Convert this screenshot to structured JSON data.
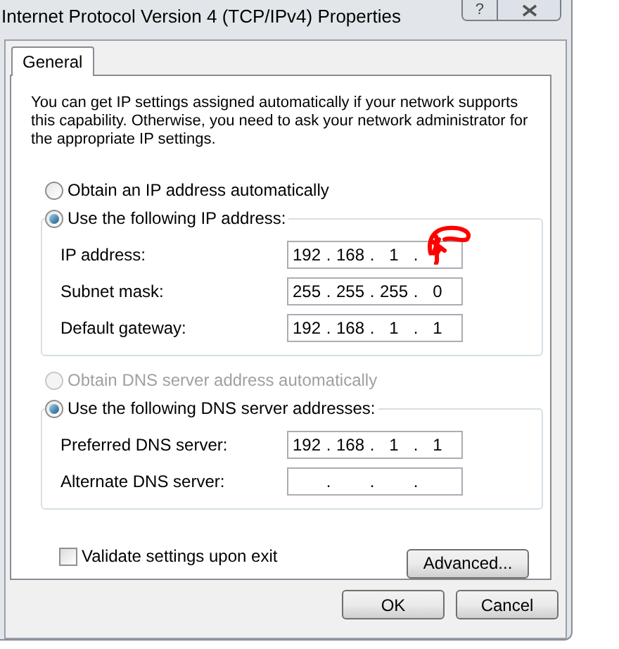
{
  "window": {
    "title": "Internet Protocol Version 4 (TCP/IPv4) Properties",
    "help": "?"
  },
  "tabs": [
    {
      "label": "General",
      "selected": true
    }
  ],
  "intro": "You can get IP settings assigned automatically if your network supports this capability. Otherwise, you need to ask your network administrator for the appropriate IP settings.",
  "ip_auto": {
    "label": "Obtain an IP address automatically",
    "selected": false,
    "disabled": false
  },
  "ip_manual": {
    "label": "Use the following IP address:",
    "selected": true,
    "disabled": false,
    "fields": [
      {
        "label": "IP address:",
        "octets": [
          "192",
          "168",
          "1"
        ],
        "separators": [
          ".",
          ".",
          "."
        ],
        "scribbled": true
      },
      {
        "label": "Subnet mask:",
        "octets": [
          "255",
          "255",
          "255",
          "0"
        ],
        "separators": [
          ".",
          ".",
          "."
        ],
        "scribbled": false
      },
      {
        "label": "Default gateway:",
        "octets": [
          "192",
          "168",
          "1",
          "1"
        ],
        "separators": [
          ".",
          ".",
          "."
        ],
        "scribbled": false
      }
    ]
  },
  "dns_auto": {
    "label": "Obtain DNS server address automatically",
    "selected": false,
    "disabled": true
  },
  "dns_manual": {
    "label": "Use the following DNS server addresses:",
    "selected": true,
    "disabled": false,
    "fields": [
      {
        "label": "Preferred DNS server:",
        "octets": [
          "192",
          "168",
          "1",
          "1"
        ],
        "separators": [
          ".",
          ".",
          "."
        ],
        "scribbled": false
      },
      {
        "label": "Alternate DNS server:",
        "separators": [
          ".",
          ".",
          "."
        ],
        "scribbled": false
      }
    ]
  },
  "validate": {
    "label": "Validate settings upon exit",
    "checked": false
  },
  "buttons": {
    "advanced": "Advanced...",
    "ok": "OK",
    "cancel": "Cancel"
  }
}
